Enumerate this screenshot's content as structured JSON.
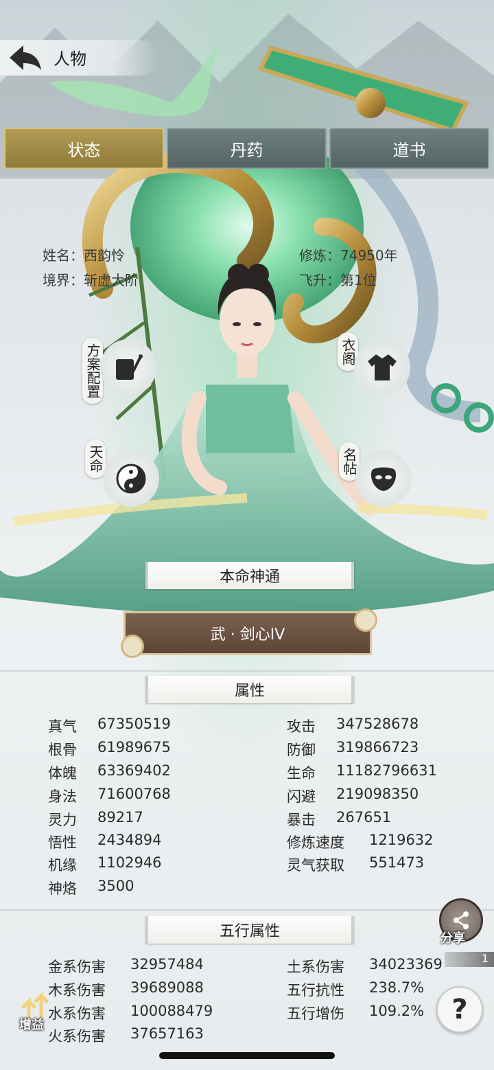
{
  "header": {
    "title": "人物"
  },
  "tabs": [
    {
      "label": "状态",
      "active": true
    },
    {
      "label": "丹药",
      "active": false
    },
    {
      "label": "道书",
      "active": false
    }
  ],
  "profile": {
    "name_label": "姓名：",
    "name_value": "西韵怜",
    "realm_label": "境界：",
    "realm_value": "斩虚大阶",
    "cultivation_label": "修炼：",
    "cultivation_value": "74950年",
    "ascension_label": "飞升：",
    "ascension_value": "第1位"
  },
  "side_buttons": {
    "plan": "方案配置",
    "wardrobe": "衣阁",
    "fate": "天命",
    "card": "名帖"
  },
  "innate_power": {
    "header": "本命神通",
    "skill": "武 · 剑心IV"
  },
  "attributes": {
    "header": "属性",
    "left": [
      {
        "k": "真气",
        "v": "67350519"
      },
      {
        "k": "根骨",
        "v": "61989675"
      },
      {
        "k": "体魄",
        "v": "63369402"
      },
      {
        "k": "身法",
        "v": "71600768"
      },
      {
        "k": "灵力",
        "v": "89217"
      },
      {
        "k": "悟性",
        "v": "2434894"
      },
      {
        "k": "机缘",
        "v": "1102946"
      },
      {
        "k": "神烙",
        "v": "3500"
      }
    ],
    "right": [
      {
        "k": "攻击",
        "v": "347528678"
      },
      {
        "k": "防御",
        "v": "319866723"
      },
      {
        "k": "生命",
        "v": "11182796631"
      },
      {
        "k": "闪避",
        "v": "219098350"
      },
      {
        "k": "暴击",
        "v": "267651"
      },
      {
        "k": "修炼速度",
        "v": "1219632"
      },
      {
        "k": "灵气获取",
        "v": "551473"
      }
    ]
  },
  "elements": {
    "header": "五行属性",
    "left": [
      {
        "k": "金系伤害",
        "v": "32957484"
      },
      {
        "k": "木系伤害",
        "v": "39689088"
      },
      {
        "k": "水系伤害",
        "v": "100088479"
      },
      {
        "k": "火系伤害",
        "v": "37657163"
      }
    ],
    "right": [
      {
        "k": "土系伤害",
        "v": "34023369"
      },
      {
        "k": "五行抗性",
        "v": "238.7%"
      },
      {
        "k": "五行增伤",
        "v": "109.2%"
      }
    ]
  },
  "floating": {
    "share": "分享",
    "share_count": "1",
    "buff": "增益",
    "help": "?"
  },
  "colors": {
    "tab_active": "#a58c48",
    "tab_inactive": "#627172",
    "skill_button": "#6a5141",
    "robe_green": "#5fae92"
  },
  "icons": [
    "back-arrow-icon",
    "share-icon",
    "help-icon",
    "buff-icon",
    "scroll-brush-icon",
    "robe-icon",
    "taiji-icon",
    "face-mask-icon"
  ]
}
